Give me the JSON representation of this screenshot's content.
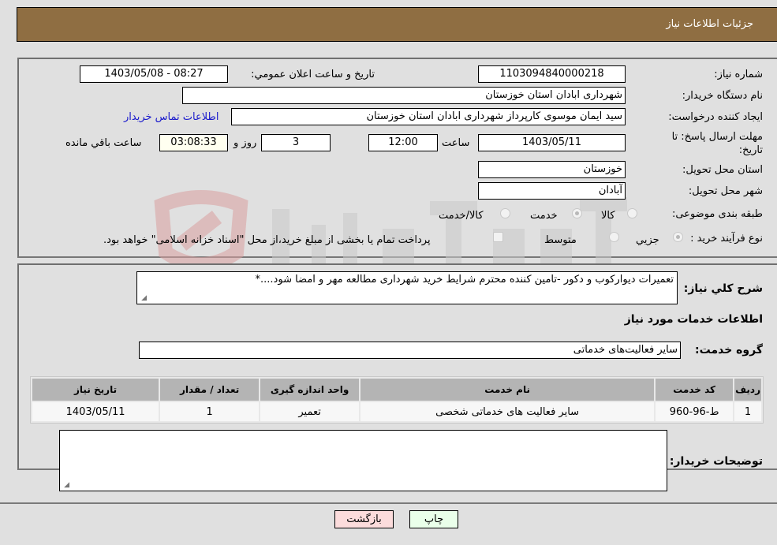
{
  "header": {
    "title": "جزئیات اطلاعات نیاز"
  },
  "need_info": {
    "need_number_label": "شماره نیاز:",
    "need_number": "1103094840000218",
    "announce_label": "تاریخ و ساعت اعلان عمومي:",
    "announce_value": "1403/05/08 - 08:27",
    "buyer_org_label": "نام دستگاه خریدار:",
    "buyer_org": "شهرداری ابادان استان خوزستان",
    "creator_label": "ایجاد کننده درخواست:",
    "creator": "سید ایمان موسوی کارپرداز شهرداری ابادان استان خوزستان",
    "buyer_contact_link": "اطلاعات تماس خریدار",
    "deadline_label_line1": "مهلت ارسال پاسخ: تا",
    "deadline_label_line2": "تاریخ:",
    "deadline_date": "1403/05/11",
    "time_label": "ساعت",
    "deadline_time": "12:00",
    "days_value": "3",
    "days_label": "روز و",
    "remaining_time": "03:08:33",
    "remaining_label": "ساعت باقي مانده",
    "province_label": "استان محل تحویل:",
    "province": "خوزستان",
    "city_label": "شهر محل تحویل:",
    "city": "آبادان",
    "category_label": "طبقه بندی موضوعی:",
    "category_options": [
      {
        "label": "کالا",
        "checked": false
      },
      {
        "label": "خدمت",
        "checked": true
      },
      {
        "label": "کالا/خدمت",
        "checked": false
      }
    ],
    "process_label": "نوع فرآیند خرید :",
    "process_options": [
      {
        "label": "جزیي",
        "checked": true
      },
      {
        "label": "متوسط",
        "checked": false
      }
    ],
    "treasury_checkbox_label": "پرداخت تمام یا بخشی از مبلغ خرید،از محل \"اسناد خزانه اسلامی\" خواهد بود."
  },
  "details": {
    "summary_label": "شرح كلي نياز:",
    "summary_text": "تعمیرات دیوارکوب و دکور -تامین کننده محترم شرایط خرید شهرداری مطالعه مهر و امضا شود....*",
    "services_heading": "اطلاعات خدمات مورد نیاز",
    "service_group_label": "گروه خدمت:",
    "service_group": "سایر فعالیت‌های خدماتی",
    "table": {
      "headers": [
        "ردیف",
        "کد خدمت",
        "نام خدمت",
        "واحد اندازه گیری",
        "تعداد / مقدار",
        "تاریخ نیاز"
      ],
      "rows": [
        [
          "1",
          "ط-96-960",
          "سایر فعالیت های خدماتی شخصی",
          "تعمیر",
          "1",
          "1403/05/11"
        ]
      ]
    },
    "buyer_notes_label": "توضیحات خریدار:",
    "buyer_notes": ""
  },
  "buttons": {
    "print": "چاپ",
    "back": "بازگشت"
  },
  "colors": {
    "header_bg": "#8f6e42",
    "back_bg": "#fcdcdc",
    "print_bg": "#eaffea",
    "link": "#1a1acc"
  }
}
